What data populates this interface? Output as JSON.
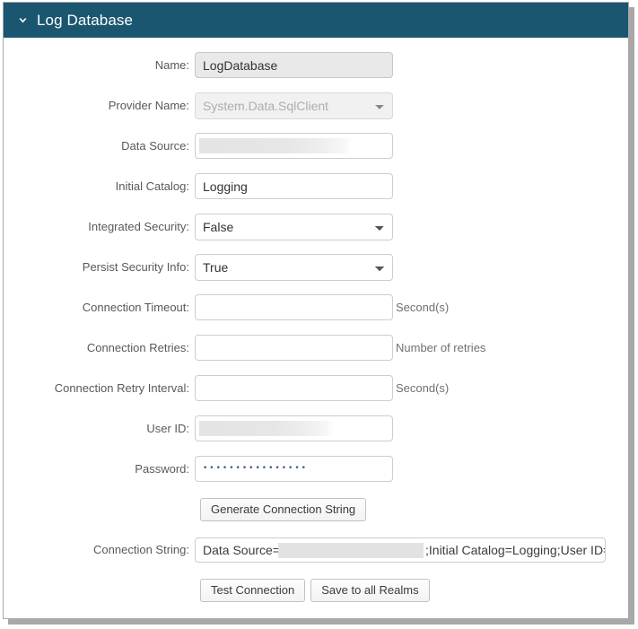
{
  "window": {
    "title": "Log Database",
    "collapse_icon": "chevron-down-icon",
    "header_color": "#1a5670"
  },
  "form": {
    "fields": [
      {
        "label": "Name:",
        "type": "text",
        "value": "LogDatabase",
        "readonly": true,
        "suffix": ""
      },
      {
        "label": "Provider Name:",
        "type": "select",
        "value": "System.Data.SqlClient",
        "disabled": true,
        "suffix": ""
      },
      {
        "label": "Data Source:",
        "type": "text",
        "value": "",
        "redacted": true,
        "suffix": ""
      },
      {
        "label": "Initial Catalog:",
        "type": "text",
        "value": "Logging",
        "readonly": false,
        "suffix": ""
      },
      {
        "label": "Integrated Security:",
        "type": "select",
        "value": "False",
        "disabled": false,
        "suffix": ""
      },
      {
        "label": "Persist Security Info:",
        "type": "select",
        "value": "True",
        "disabled": false,
        "suffix": ""
      },
      {
        "label": "Connection Timeout:",
        "type": "text",
        "value": "",
        "readonly": false,
        "suffix": "Second(s)"
      },
      {
        "label": "Connection Retries:",
        "type": "text",
        "value": "",
        "readonly": false,
        "suffix": "Number of retries"
      },
      {
        "label": "Connection Retry Interval:",
        "type": "text",
        "value": "",
        "readonly": false,
        "suffix": "Second(s)"
      },
      {
        "label": "User ID:",
        "type": "text",
        "value": "",
        "redacted": true,
        "suffix": ""
      },
      {
        "label": "Password:",
        "type": "password",
        "value": "••••••••••••••••",
        "readonly": false,
        "suffix": ""
      }
    ],
    "generate_button": "Generate Connection String",
    "connection_string_label": "Connection String:",
    "connection_string_prefix": "Data Source=",
    "connection_string_suffix": ";Initial Catalog=Logging;User ID=S",
    "test_connection_button": "Test Connection",
    "save_all_realms_button": "Save to all Realms"
  }
}
